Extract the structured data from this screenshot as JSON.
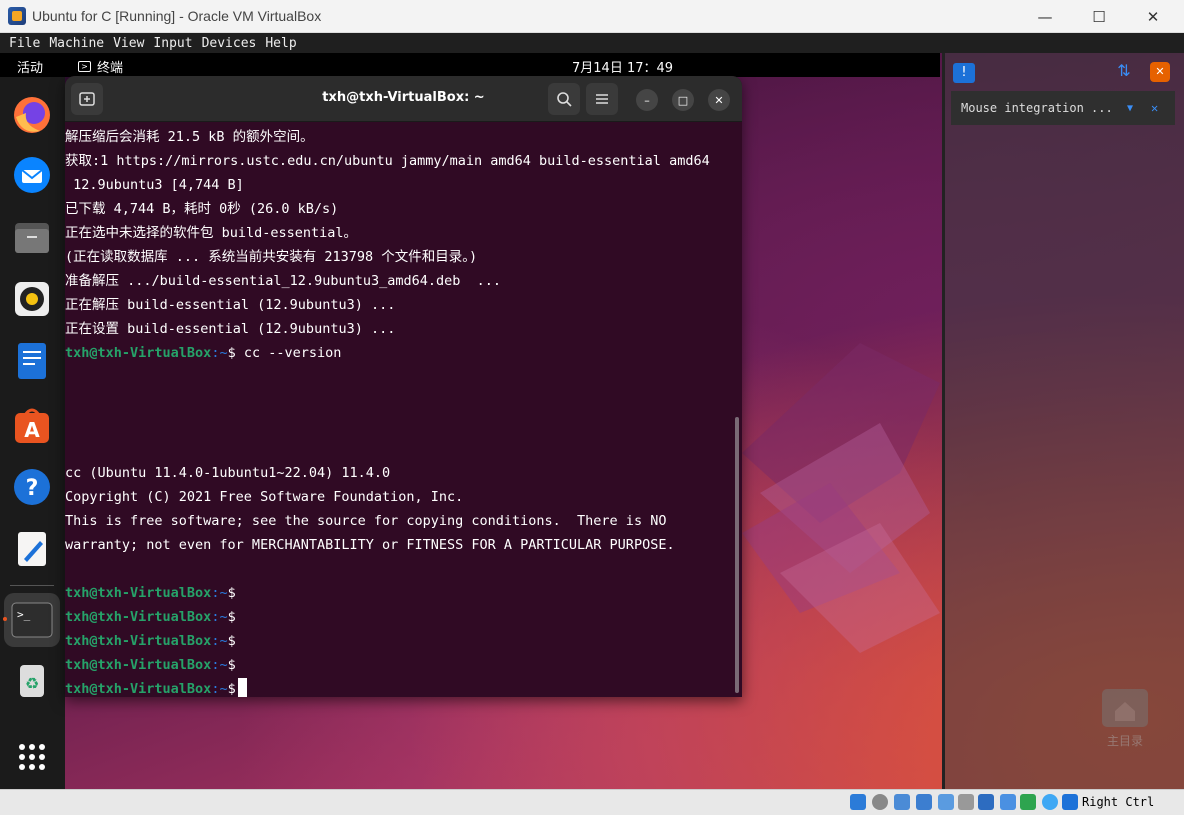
{
  "window": {
    "title": "Ubuntu for C [Running] - Oracle VM VirtualBox",
    "minimize": "—",
    "maximize": "☐",
    "close": "✕"
  },
  "menu": [
    "File",
    "Machine",
    "View",
    "Input",
    "Devices",
    "Help"
  ],
  "topbar": {
    "activities": "活动",
    "app": "终端",
    "clock": "7月14日  17：49"
  },
  "terminal": {
    "title": "txh@txh-VirtualBox: ~",
    "lines": [
      {
        "text": "解压缩后会消耗 21.5 kB 的额外空间。"
      },
      {
        "text": "获取:1 https://mirrors.ustc.edu.cn/ubuntu jammy/main amd64 build-essential amd64"
      },
      {
        "text": " 12.9ubuntu3 [4,744 B]"
      },
      {
        "text": "已下载 4,744 B，耗时 0秒 (26.0 kB/s)"
      },
      {
        "text": "正在选中未选择的软件包 build-essential。"
      },
      {
        "text": "(正在读取数据库 ... 系统当前共安装有 213798 个文件和目录。)"
      },
      {
        "text": "准备解压 .../build-essential_12.9ubuntu3_amd64.deb  ..."
      },
      {
        "text": "正在解压 build-essential (12.9ubuntu3) ..."
      },
      {
        "text": "正在设置 build-essential (12.9ubuntu3) ..."
      }
    ],
    "prompt_user": "txh@txh-VirtualBox",
    "prompt_path": ":~",
    "prompt_sign": "$",
    "command": " cc --version",
    "output": [
      "cc (Ubuntu 11.4.0-1ubuntu1~22.04) 11.4.0",
      "Copyright (C) 2021 Free Software Foundation, Inc.",
      "This is free software; see the source for copying conditions.  There is NO",
      "warranty; not even for MERCHANTABILITY or FITNESS FOR A PARTICULAR PURPOSE."
    ]
  },
  "notification": {
    "text": "Mouse integration ..."
  },
  "desktop": {
    "home_label": "主目录"
  },
  "statusbar": {
    "host_key": "Right Ctrl"
  },
  "dock_icons": [
    "firefox-icon",
    "thunderbird-icon",
    "files-icon",
    "rhythmbox-icon",
    "writer-icon",
    "app-center-icon",
    "help-icon",
    "text-editor-icon",
    "terminal-icon",
    "trash-icon",
    "apps-grid-icon"
  ]
}
